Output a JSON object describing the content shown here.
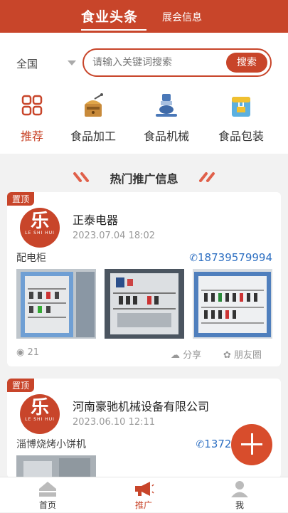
{
  "header": {
    "tabs": [
      {
        "label": "食业头条"
      },
      {
        "label": "展会信息"
      }
    ]
  },
  "search": {
    "region": "全国",
    "placeholder": "请输入关键词搜索",
    "button": "搜索"
  },
  "categories": [
    {
      "label": "推荐",
      "icon": "grid-icon",
      "active": true
    },
    {
      "label": "食品加工",
      "icon": "grinder-icon"
    },
    {
      "label": "食品机械",
      "icon": "machine-icon"
    },
    {
      "label": "食品包装",
      "icon": "package-icon"
    }
  ],
  "section": {
    "title": "热门推广信息"
  },
  "posts": [
    {
      "badge": "置顶",
      "logo_char": "乐",
      "logo_sub": "LE SHI HUI",
      "company": "正泰电器",
      "date": "2023.07.04 18:02",
      "product": "配电柜",
      "phone": "18739579994",
      "views": "21",
      "share": "分享",
      "moments": "朋友圈"
    },
    {
      "badge": "置顶",
      "logo_char": "乐",
      "logo_sub": "LE SHI HUI",
      "company": "河南豪驰机械设备有限公司",
      "date": "2023.06.10 12:11",
      "product": "淄博烧烤小饼机",
      "phone": "13721"
    }
  ],
  "bottom_nav": [
    {
      "label": "首页"
    },
    {
      "label": "推广",
      "active": true
    },
    {
      "label": "我"
    }
  ],
  "colors": {
    "brand": "#c8452a",
    "link": "#2d6fc2"
  }
}
